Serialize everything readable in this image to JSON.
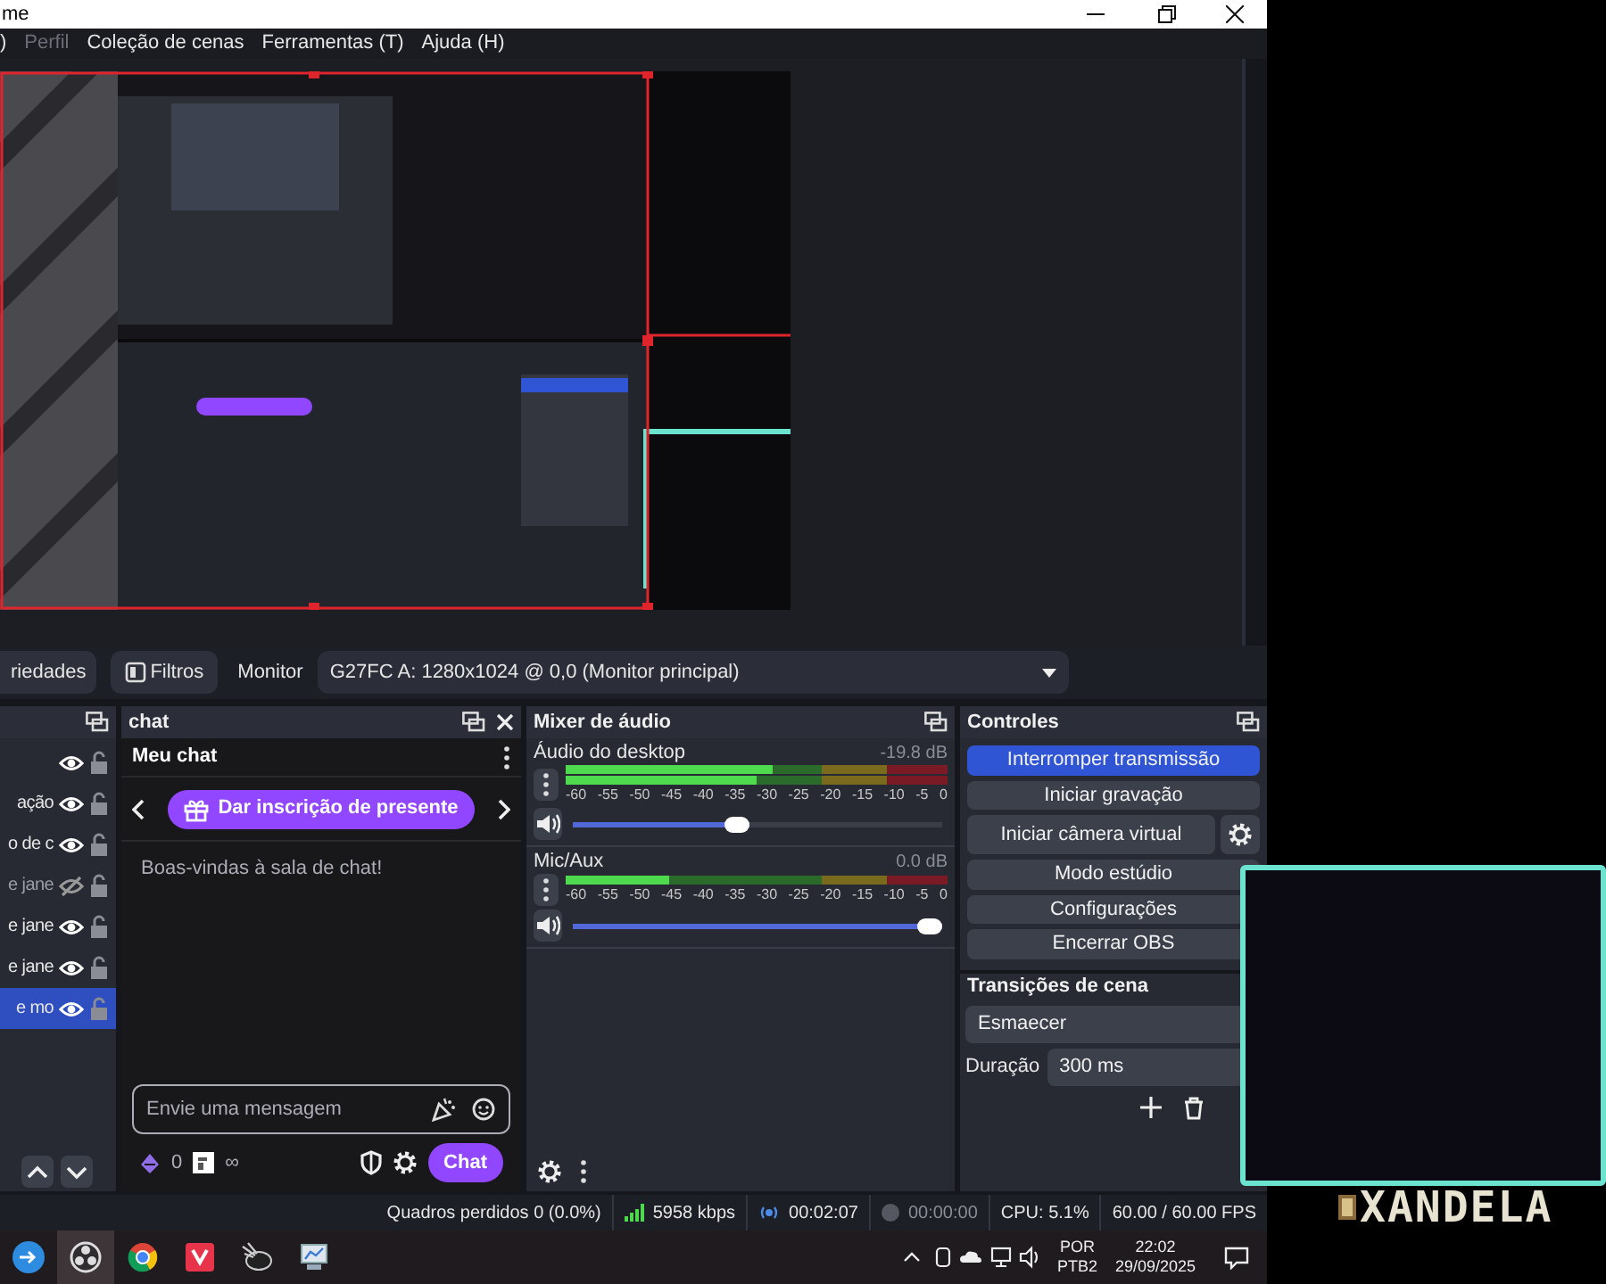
{
  "window": {
    "title": "me"
  },
  "menu": [
    {
      "label": ")",
      "disabled": false
    },
    {
      "label": "Perfil",
      "disabled": true
    },
    {
      "label": "Coleção de cenas",
      "disabled": false
    },
    {
      "label": "Ferramentas (T)",
      "disabled": false
    },
    {
      "label": "Ajuda (H)",
      "disabled": false
    }
  ],
  "source_toolbar": {
    "properties_button": "riedades",
    "filters_button": "Filtros",
    "monitor_label": "Monitor",
    "monitor_select": "G27FC A: 1280x1024 @ 0,0 (Monitor principal)"
  },
  "sources": {
    "items": [
      {
        "visible": true,
        "selected": false
      },
      {
        "label": "ação",
        "visible": true,
        "selected": false
      },
      {
        "label": "o de c",
        "visible": true,
        "selected": false
      },
      {
        "label": "e jane",
        "visible": false,
        "selected": false
      },
      {
        "label": "e jane",
        "visible": true,
        "selected": false
      },
      {
        "label": "e jane",
        "visible": true,
        "selected": false
      },
      {
        "label": "e mo",
        "visible": true,
        "selected": true
      }
    ]
  },
  "chat": {
    "title": "chat",
    "channel": "Meu chat",
    "gift_button": "Dar inscrição de presente",
    "messages": [
      "Boas-vindas à sala de chat!"
    ],
    "input": {
      "placeholder": "Envie uma mensagem"
    },
    "points": "0",
    "infinity": "∞",
    "send_button": "Chat"
  },
  "mixer": {
    "title": "Mixer de áudio",
    "channels": [
      {
        "name": "Áudio do desktop",
        "reading": "-19.8 dB",
        "meters": [
          {
            "level": 0.54
          },
          {
            "level": 0.5
          }
        ],
        "scale": [
          "-60",
          "-55",
          "-50",
          "-45",
          "-40",
          "-35",
          "-30",
          "-25",
          "-20",
          "-15",
          "-10",
          "-5",
          "0"
        ],
        "volume": {
          "level": 0.48
        }
      },
      {
        "name": "Mic/Aux",
        "reading": "0.0 dB",
        "meters": [
          {
            "level": 0.27
          }
        ],
        "scale": [
          "-60",
          "-55",
          "-50",
          "-45",
          "-40",
          "-35",
          "-30",
          "-25",
          "-20",
          "-15",
          "-10",
          "-5",
          "0"
        ],
        "volume": {
          "level": 1
        }
      }
    ]
  },
  "controls": {
    "title": "Controles",
    "buttons": [
      {
        "label": "Interromper transmissão",
        "kind": "plain",
        "active": true
      },
      {
        "label": "Iniciar gravação",
        "kind": "plain",
        "active": false
      },
      {
        "label": "Iniciar câmera virtual",
        "kind": "with_settings",
        "active": false
      },
      {
        "label": "Modo estúdio",
        "kind": "plain",
        "active": false
      },
      {
        "label": "Configurações",
        "kind": "plain",
        "active": false
      },
      {
        "label": "Encerrar OBS",
        "kind": "plain",
        "active": false
      }
    ]
  },
  "transitions": {
    "title": "Transições de cena",
    "select": "Esmaecer",
    "duration_label": "Duração",
    "duration": "300 ms"
  },
  "status_bar": [
    {
      "kind": "dropped",
      "text": "Quadros perdidos 0 (0.0%)"
    },
    {
      "kind": "bitrate",
      "text": "5958 kbps"
    },
    {
      "kind": "stream_time",
      "text": "00:02:07"
    },
    {
      "kind": "record_time",
      "text": "00:00:00"
    },
    {
      "kind": "cpu",
      "text": "CPU: 5.1%"
    },
    {
      "kind": "fps",
      "text": "60.00 / 60.00 FPS"
    }
  ],
  "taskbar": {
    "apps": [
      {
        "kind": "swirl",
        "selected": false
      },
      {
        "kind": "aperture",
        "selected": true
      },
      {
        "kind": "ball",
        "selected": false
      },
      {
        "kind": "red_square",
        "selected": false
      },
      {
        "kind": "bird",
        "selected": false
      },
      {
        "kind": "monitor",
        "selected": false
      }
    ],
    "keyboard": [
      "POR",
      "PTB2"
    ],
    "time": "22:02",
    "date": "29/09/2025"
  },
  "overlay": {
    "logo_text": "XANDELA"
  }
}
